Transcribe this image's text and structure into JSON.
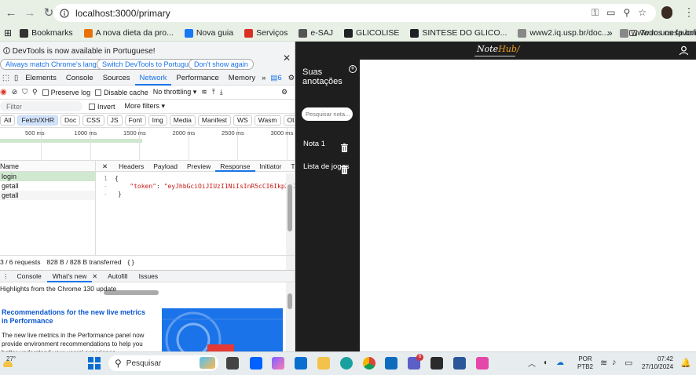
{
  "browser": {
    "url": "localhost:3000/primary",
    "bookmarks": [
      {
        "label": "Bookmarks",
        "icon": "star-icon",
        "color": "#333333"
      },
      {
        "label": "A nova dieta da pro...",
        "icon": "book-icon",
        "color": "#e8710a"
      },
      {
        "label": "Nova guia",
        "icon": "facebook-icon",
        "color": "#1877f2"
      },
      {
        "label": "Serviços",
        "icon": "globe-icon",
        "color": "#d93025"
      },
      {
        "label": "e-SAJ",
        "icon": "bank-icon",
        "color": "#555555"
      },
      {
        "label": "GLICOLISE",
        "icon": "globe-icon",
        "color": "#202124"
      },
      {
        "label": "SINTESE DO GLICO...",
        "icon": "globe-icon",
        "color": "#202124"
      },
      {
        "label": "www2.iq.usp.br/doc...",
        "icon": "image-icon",
        "color": "#888888"
      },
      {
        "label": "www.rc.unesp.br/ib/...",
        "icon": "image-icon",
        "color": "#888888"
      }
    ],
    "bookmarks_more": "»",
    "all_bookmarks": "Todos os favoritos"
  },
  "devtools": {
    "infobar_message": "DevTools is now available in Portuguese!",
    "infobar_buttons": [
      "Always match Chrome's language",
      "Switch DevTools to Portuguese",
      "Don't show again"
    ],
    "tabs": [
      "Elements",
      "Console",
      "Sources",
      "Network",
      "Performance",
      "Memory"
    ],
    "active_tab": "Network",
    "issues_count": "6",
    "toolbar": {
      "preserve_log": "Preserve log",
      "disable_cache": "Disable cache",
      "throttle": "No throttling"
    },
    "filter": {
      "placeholder": "Filter",
      "invert": "Invert",
      "more_filters": "More filters"
    },
    "type_filters": [
      "All",
      "Fetch/XHR",
      "Doc",
      "CSS",
      "JS",
      "Font",
      "Img",
      "Media",
      "Manifest",
      "WS",
      "Wasm",
      "Other"
    ],
    "active_type": "Fetch/XHR",
    "timeline_ticks": [
      "500 ms",
      "1000 ms",
      "1500 ms",
      "2000 ms",
      "2500 ms",
      "3000 ms"
    ],
    "requests_header": "Name",
    "requests": [
      "login",
      "getall",
      "getall"
    ],
    "detail_tabs": [
      "Headers",
      "Payload",
      "Preview",
      "Response",
      "Initiator",
      "Timing"
    ],
    "active_detail_tab": "Response",
    "response_lines": [
      {
        "num": "1",
        "text": "{"
      },
      {
        "num": "-",
        "key": "\"token\"",
        "value": "\"eyJhbGciOiJIUzI1NiIsInR5cCI6IkpXVCJ9.ey"
      },
      {
        "num": "-",
        "text": "}"
      }
    ],
    "status": {
      "requests": "3 / 6 requests",
      "transferred": "828 B / 828 B transferred",
      "braces": "{ }"
    },
    "drawer_tabs": [
      "Console",
      "What's new",
      "Autofill",
      "Issues"
    ],
    "active_drawer": "What's new",
    "whatsnew": {
      "heading": "Highlights from the Chrome 130 update",
      "title": "Recommendations for the new live metrics in Performance",
      "body": "The new live metrics in the Performance panel now provide environment recommendations to help you better understand your users' experience."
    }
  },
  "app": {
    "logo_note": "Note",
    "logo_hub": "Hub",
    "sidebar_title": "Suas anotações",
    "search_placeholder": "Pesquisar nota...",
    "notes": [
      "Nota 1",
      "Lista de jogos"
    ]
  },
  "taskbar": {
    "temperature": "27°",
    "search": "Pesquisar",
    "lang": "POR",
    "layout": "PTB2",
    "time": "07:42",
    "date": "27/10/2024",
    "teams_badge": "6"
  }
}
